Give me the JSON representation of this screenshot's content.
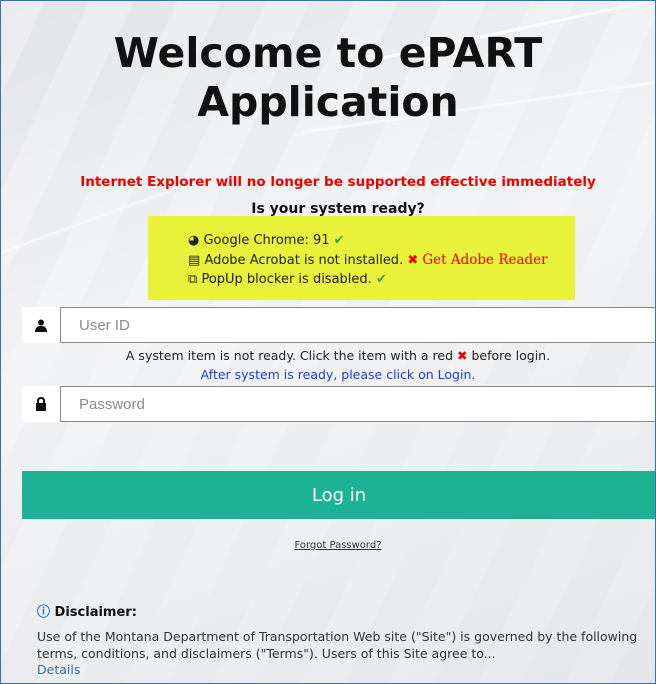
{
  "title_line1": "Welcome to ePART",
  "title_line2": "Application",
  "warning": "Internet Explorer will no longer be supported effective immediately",
  "ready_heading": "Is your system ready?",
  "checks": {
    "chrome": "Google Chrome: 91",
    "acrobat": "Adobe Acrobat is not installed.",
    "acrobat_link": "Get Adobe Reader",
    "popup": "PopUp blocker is disabled."
  },
  "userid": {
    "placeholder": "User ID"
  },
  "password": {
    "placeholder": "Password"
  },
  "note_line1_a": "A system item is not ready. Click the item with a red",
  "note_line1_b": "before login.",
  "note_line2": "After system is ready, please click on Login.",
  "login_label": "Log in",
  "forgot_label": "Forgot Password?",
  "disclaimer_heading": "Disclaimer:",
  "disclaimer_text": "Use of the Montana Department of Transportation Web site (\"Site\") is governed by the following terms, conditions, and disclaimers (\"Terms\"). Users of this Site agree to...",
  "details_label": "Details",
  "colors": {
    "accent": "#1bb394",
    "warning": "#ee0000",
    "highlight": "#e9f23a",
    "link": "#1a3fd8"
  },
  "icons": [
    "chrome-icon",
    "pdf-icon",
    "external-link-icon",
    "check-icon",
    "x-icon",
    "user-icon",
    "lock-icon",
    "info-icon"
  ]
}
